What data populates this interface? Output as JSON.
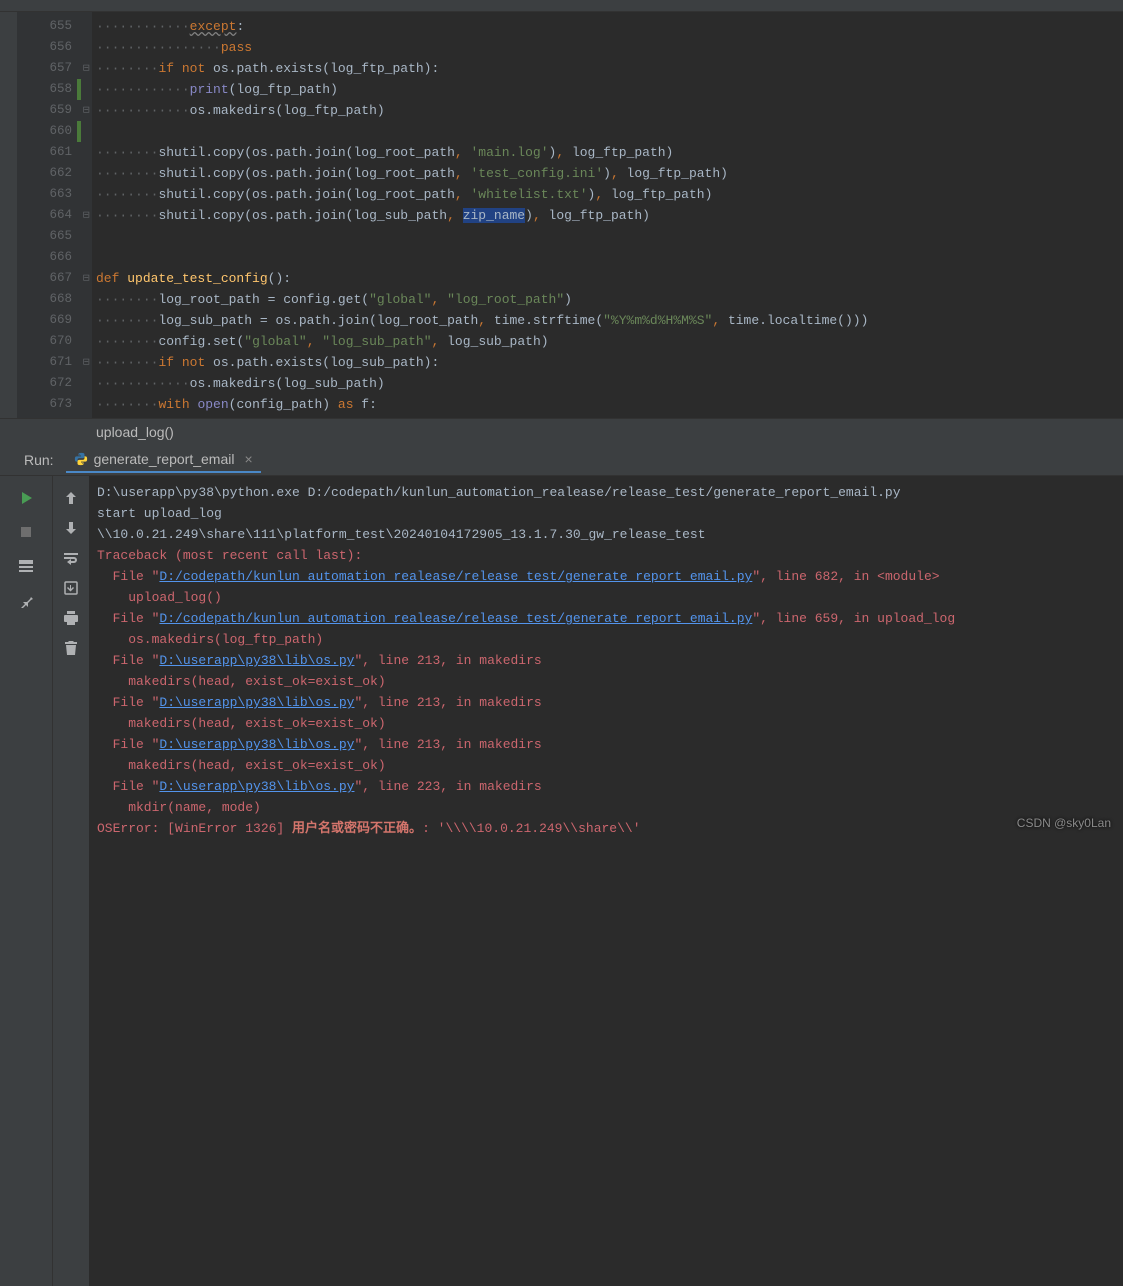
{
  "gutter": {
    "start": 655,
    "end": 673
  },
  "code_lines": [
    {
      "ln": 655,
      "indent": 3,
      "html": "<span class='kw underline'>except</span>:"
    },
    {
      "ln": 656,
      "indent": 4,
      "html": "<span class='kw'>pass</span>"
    },
    {
      "ln": 657,
      "indent": 2,
      "fold": "-",
      "html": "<span class='kw'>if not </span>os.path.exists(log_ftp_path):"
    },
    {
      "ln": 658,
      "indent": 3,
      "change": true,
      "html": "<span class='builtin'>print</span>(log_ftp_path)"
    },
    {
      "ln": 659,
      "indent": 3,
      "fold": "-",
      "html": "os.makedirs(log_ftp_path)"
    },
    {
      "ln": 660,
      "indent": 0,
      "change": true,
      "html": ""
    },
    {
      "ln": 661,
      "indent": 2,
      "html": "shutil.copy(os.path.join(log_root_path<span class='kw'>, </span><span class='str'>'main.log'</span>)<span class='kw'>, </span>log_ftp_path)"
    },
    {
      "ln": 662,
      "indent": 2,
      "html": "shutil.copy(os.path.join(log_root_path<span class='kw'>, </span><span class='str'>'test_config.ini'</span>)<span class='kw'>, </span>log_ftp_path)"
    },
    {
      "ln": 663,
      "indent": 2,
      "html": "shutil.copy(os.path.join(log_root_path<span class='kw'>, </span><span class='str'>'whitelist.txt'</span>)<span class='kw'>, </span>log_ftp_path)"
    },
    {
      "ln": 664,
      "indent": 2,
      "fold": "-",
      "html": "shutil.copy(os.path.join(log_sub_path<span class='kw'>, </span><span class='sel'>zip_name</span>)<span class='kw'>, </span>log_ftp_path)"
    },
    {
      "ln": 665,
      "indent": 0,
      "html": ""
    },
    {
      "ln": 666,
      "indent": 0,
      "html": ""
    },
    {
      "ln": 667,
      "indent": 0,
      "fold": "-",
      "html": "<span class='kw'>def </span><span class='fn'>update_test_config</span>():"
    },
    {
      "ln": 668,
      "indent": 2,
      "html": "log_root_path = config.get(<span class='str'>\"global\"</span><span class='kw'>, </span><span class='str'>\"log_root_path\"</span>)"
    },
    {
      "ln": 669,
      "indent": 2,
      "html": "log_sub_path = os.path.join(log_root_path<span class='kw'>, </span>time.strftime(<span class='str'>\"%Y%m%d%H%M%S\"</span><span class='kw'>, </span>time.localtime()))"
    },
    {
      "ln": 670,
      "indent": 2,
      "html": "config.set(<span class='str'>\"global\"</span><span class='kw'>, </span><span class='str'>\"log_sub_path\"</span><span class='kw'>, </span>log_sub_path)"
    },
    {
      "ln": 671,
      "indent": 2,
      "fold": "-",
      "html": "<span class='kw'>if not </span>os.path.exists(log_sub_path):"
    },
    {
      "ln": 672,
      "indent": 3,
      "html": "os.makedirs(log_sub_path)"
    },
    {
      "ln": 673,
      "indent": 2,
      "html": "<span class='kw'>with </span><span class='builtin'>open</span>(config_path) <span class='kw'>as </span>f:"
    }
  ],
  "breadcrumb": "upload_log()",
  "run": {
    "label": "Run:",
    "tab_name": "generate_report_email"
  },
  "console_lines": [
    {
      "cls": "",
      "text": "D:\\userapp\\py38\\python.exe D:/codepath/kunlun_automation_realease/release_test/generate_report_email.py"
    },
    {
      "cls": "",
      "text": "start upload_log"
    },
    {
      "cls": "",
      "text": "\\\\10.0.21.249\\share\\111\\platform_test\\20240104172905_13.1.7.30_gw_release_test"
    },
    {
      "cls": "err",
      "text": "Traceback (most recent call last):"
    },
    {
      "cls": "err",
      "parts": [
        {
          "t": "  File \"",
          "c": "err"
        },
        {
          "t": "D:/codepath/kunlun_automation_realease/release_test/generate_report_email.py",
          "c": "link"
        },
        {
          "t": "\", line 682, in <module>",
          "c": "err"
        }
      ]
    },
    {
      "cls": "err",
      "text": "    upload_log()"
    },
    {
      "cls": "err",
      "parts": [
        {
          "t": "  File \"",
          "c": "err"
        },
        {
          "t": "D:/codepath/kunlun_automation_realease/release_test/generate_report_email.py",
          "c": "link"
        },
        {
          "t": "\", line 659, in upload_log",
          "c": "err"
        }
      ]
    },
    {
      "cls": "err",
      "text": "    os.makedirs(log_ftp_path)"
    },
    {
      "cls": "err",
      "parts": [
        {
          "t": "  File \"",
          "c": "err"
        },
        {
          "t": "D:\\userapp\\py38\\lib\\os.py",
          "c": "link"
        },
        {
          "t": "\", line 213, in makedirs",
          "c": "err"
        }
      ]
    },
    {
      "cls": "err",
      "text": "    makedirs(head, exist_ok=exist_ok)"
    },
    {
      "cls": "err",
      "parts": [
        {
          "t": "  File \"",
          "c": "err"
        },
        {
          "t": "D:\\userapp\\py38\\lib\\os.py",
          "c": "link"
        },
        {
          "t": "\", line 213, in makedirs",
          "c": "err"
        }
      ]
    },
    {
      "cls": "err",
      "text": "    makedirs(head, exist_ok=exist_ok)"
    },
    {
      "cls": "err",
      "parts": [
        {
          "t": "  File \"",
          "c": "err"
        },
        {
          "t": "D:\\userapp\\py38\\lib\\os.py",
          "c": "link"
        },
        {
          "t": "\", line 213, in makedirs",
          "c": "err"
        }
      ]
    },
    {
      "cls": "err",
      "text": "    makedirs(head, exist_ok=exist_ok)"
    },
    {
      "cls": "err",
      "parts": [
        {
          "t": "  File \"",
          "c": "err"
        },
        {
          "t": "D:\\userapp\\py38\\lib\\os.py",
          "c": "link"
        },
        {
          "t": "\", line 223, in makedirs",
          "c": "err"
        }
      ]
    },
    {
      "cls": "err",
      "text": "    mkdir(name, mode)"
    },
    {
      "cls": "err",
      "parts": [
        {
          "t": "OSError: [WinError 1326] ",
          "c": "err"
        },
        {
          "t": "用户名或密码不正确。",
          "c": "bold"
        },
        {
          "t": ": '\\\\\\\\10.0.21.249\\\\share\\\\'",
          "c": "err"
        }
      ]
    }
  ],
  "watermark": "CSDN @sky0Lan"
}
